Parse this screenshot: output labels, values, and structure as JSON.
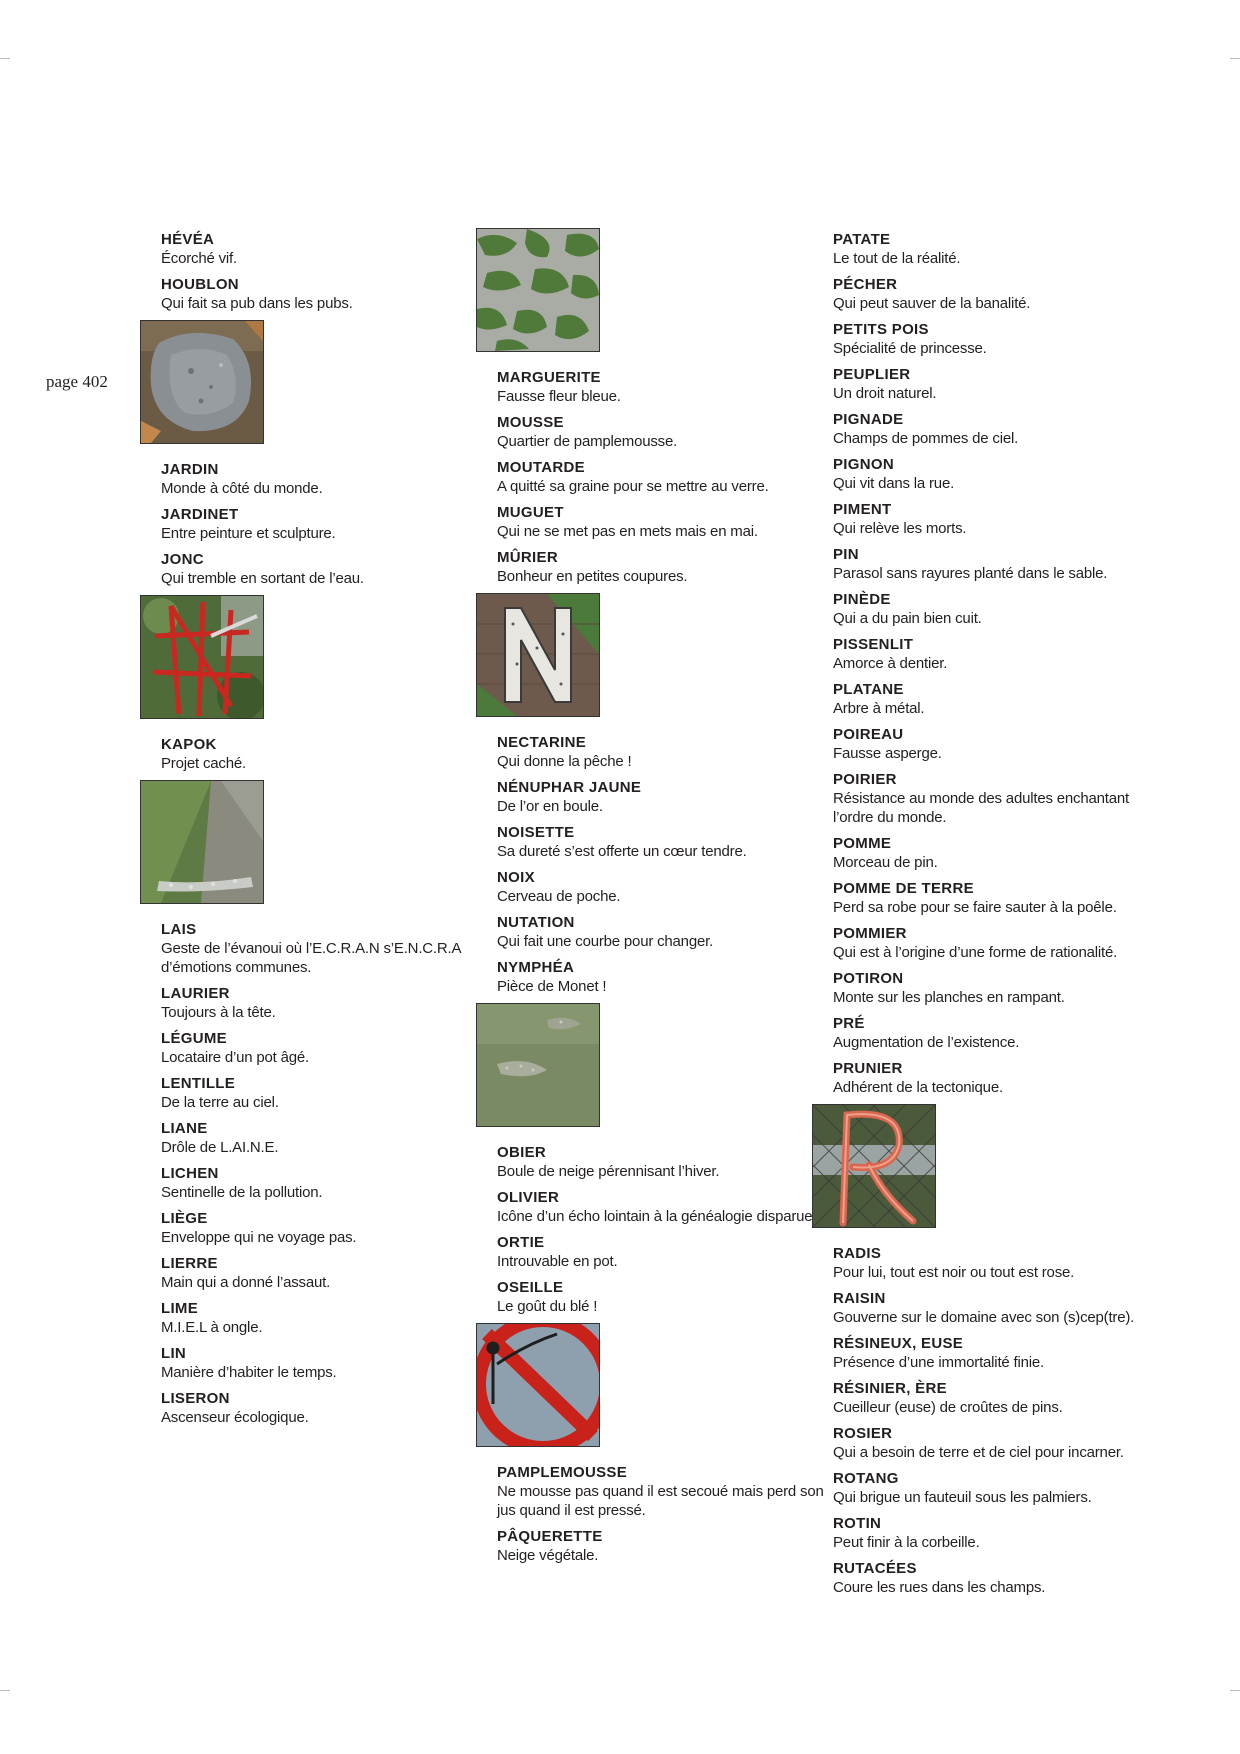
{
  "page_label": "page 402",
  "columns": [
    {
      "blocks": [
        {
          "type": "entry",
          "term": "HÉVÉA",
          "def": "Écorché vif."
        },
        {
          "type": "entry",
          "term": "HOUBLON",
          "def": "Qui fait sa pub dans les pubs."
        },
        {
          "type": "photo",
          "icon": "stone-photo"
        },
        {
          "type": "entry",
          "term": "JARDIN",
          "def": "Monde à côté du monde."
        },
        {
          "type": "entry",
          "term": "JARDINET",
          "def": "Entre peinture et sculpture."
        },
        {
          "type": "entry",
          "term": "JONC",
          "def": "Qui tremble en sortant de l’eau."
        },
        {
          "type": "photo",
          "icon": "red-sculpture-photo"
        },
        {
          "type": "entry",
          "term": "KAPOK",
          "def": "Projet caché."
        },
        {
          "type": "photo",
          "icon": "grass-slope-photo"
        },
        {
          "type": "entry",
          "term": "LAIS",
          "def": "Geste de l’évanoui où l’E.C.R.A.N  s’E.N.C.R.A d’émotions communes."
        },
        {
          "type": "entry",
          "term": "LAURIER",
          "def": "Toujours à la tête."
        },
        {
          "type": "entry",
          "term": "LÉGUME",
          "def": "Locataire d’un pot âgé."
        },
        {
          "type": "entry",
          "term": "LENTILLE",
          "def": "De la terre au ciel."
        },
        {
          "type": "entry",
          "term": "LIANE",
          "def": "Drôle de L.AI.N.E."
        },
        {
          "type": "entry",
          "term": "LICHEN",
          "def": "Sentinelle de la pollution."
        },
        {
          "type": "entry",
          "term": "LIÈGE",
          "def": "Enveloppe qui ne voyage pas."
        },
        {
          "type": "entry",
          "term": "LIERRE",
          "def": "Main qui a donné l’assaut."
        },
        {
          "type": "entry",
          "term": "LIME",
          "def": "M.I.E.L à ongle."
        },
        {
          "type": "entry",
          "term": "LIN",
          "def": "Manière d’habiter le temps."
        },
        {
          "type": "entry",
          "term": "LISERON",
          "def": "Ascenseur écologique."
        }
      ]
    },
    {
      "blocks": [
        {
          "type": "photo",
          "icon": "moss-photo"
        },
        {
          "type": "entry",
          "term": "MARGUERITE",
          "def": "Fausse fleur bleue."
        },
        {
          "type": "entry",
          "term": "MOUSSE",
          "def": "Quartier de pamplemousse."
        },
        {
          "type": "entry",
          "term": "MOUTARDE",
          "def": "A quitté sa graine pour se mettre au verre."
        },
        {
          "type": "entry",
          "term": "MUGUET",
          "def": "Qui ne se met pas en mets mais en mai."
        },
        {
          "type": "entry",
          "term": "MÛRIER",
          "def": "Bonheur en petites coupures."
        },
        {
          "type": "photo",
          "icon": "letter-n-sign-photo"
        },
        {
          "type": "entry",
          "term": "NECTARINE",
          "def": "Qui donne la pêche !"
        },
        {
          "type": "entry",
          "term": "NÉNUPHAR JAUNE",
          "def": "De l’or en boule."
        },
        {
          "type": "entry",
          "term": "NOISETTE",
          "def": "Sa dureté s’est offerte un cœur tendre."
        },
        {
          "type": "entry",
          "term": "NOIX",
          "def": "Cerveau de poche."
        },
        {
          "type": "entry",
          "term": "NUTATION",
          "def": "Qui fait une courbe pour changer."
        },
        {
          "type": "entry",
          "term": "NYMPHÉA",
          "def": "Pièce de Monet !"
        },
        {
          "type": "photo",
          "icon": "lawn-photo"
        },
        {
          "type": "entry",
          "term": "OBIER",
          "def": "Boule de neige pérennisant l’hiver."
        },
        {
          "type": "entry",
          "term": "OLIVIER",
          "def": "Icône d’un écho lointain à la généalogie disparue."
        },
        {
          "type": "entry",
          "term": "ORTIE",
          "def": "Introuvable en pot."
        },
        {
          "type": "entry",
          "term": "OSEILLE",
          "def": "Le goût du blé !"
        },
        {
          "type": "photo",
          "icon": "prohibition-sign-photo"
        },
        {
          "type": "entry",
          "term": "PAMPLEMOUSSE",
          "def": "Ne mousse pas quand il est secoué mais perd son jus quand il est pressé."
        },
        {
          "type": "entry",
          "term": "PÂQUERETTE",
          "def": "Neige végétale."
        }
      ]
    },
    {
      "blocks": [
        {
          "type": "entry",
          "term": "PATATE",
          "def": "Le tout de la réalité."
        },
        {
          "type": "entry",
          "term": "PÉCHER",
          "def": "Qui peut sauver de la banalité."
        },
        {
          "type": "entry",
          "term": "PETITS POIS",
          "def": "Spécialité de princesse."
        },
        {
          "type": "entry",
          "term": "PEUPLIER",
          "def": "Un droit naturel."
        },
        {
          "type": "entry",
          "term": "PIGNADE",
          "def": "Champs de pommes de ciel."
        },
        {
          "type": "entry",
          "term": "PIGNON",
          "def": "Qui vit dans la rue."
        },
        {
          "type": "entry",
          "term": "PIMENT",
          "def": "Qui relève les morts."
        },
        {
          "type": "entry",
          "term": "PIN",
          "def": "Parasol sans rayures planté dans le sable."
        },
        {
          "type": "entry",
          "term": "PINÈDE",
          "def": "Qui a du pain bien cuit."
        },
        {
          "type": "entry",
          "term": "PISSENLIT",
          "def": "Amorce à dentier."
        },
        {
          "type": "entry",
          "term": "PLATANE",
          "def": "Arbre à métal."
        },
        {
          "type": "entry",
          "term": "POIREAU",
          "def": "Fausse asperge."
        },
        {
          "type": "entry",
          "term": "POIRIER",
          "def": "Résistance au monde des adultes enchantant l’ordre du monde."
        },
        {
          "type": "entry",
          "term": "POMME",
          "def": "Morceau de pin."
        },
        {
          "type": "entry",
          "term": "POMME DE TERRE",
          "def": "Perd sa robe pour se faire sauter à la poêle."
        },
        {
          "type": "entry",
          "term": "POMMIER",
          "def": "Qui est à l’origine d’une forme de rationalité."
        },
        {
          "type": "entry",
          "term": "POTIRON",
          "def": "Monte sur les planches en rampant."
        },
        {
          "type": "entry",
          "term": "PRÉ",
          "def": "Augmentation de l’existence."
        },
        {
          "type": "entry",
          "term": "PRUNIER",
          "def": "Adhérent de la tectonique."
        },
        {
          "type": "photo",
          "icon": "fence-letter-r-photo"
        },
        {
          "type": "entry",
          "term": "RADIS",
          "def": "Pour lui, tout est noir ou tout est rose."
        },
        {
          "type": "entry",
          "term": "RAISIN",
          "def": "Gouverne sur le domaine avec son (s)cep(tre)."
        },
        {
          "type": "entry",
          "term": "RÉSINEUX, EUSE",
          "def": "Présence d’une immortalité finie."
        },
        {
          "type": "entry",
          "term": "RÉSINIER, ÈRE",
          "def": "Cueilleur (euse) de croûtes de pins."
        },
        {
          "type": "entry",
          "term": "ROSIER",
          "def": "Qui a besoin de terre et de ciel pour incarner."
        },
        {
          "type": "entry",
          "term": "ROTANG",
          "def": "Qui brigue un fauteuil sous les palmiers."
        },
        {
          "type": "entry",
          "term": "ROTIN",
          "def": "Peut finir à la corbeille."
        },
        {
          "type": "entry",
          "term": "RUTACÉES",
          "def": "Coure les rues dans les champs."
        }
      ]
    }
  ]
}
